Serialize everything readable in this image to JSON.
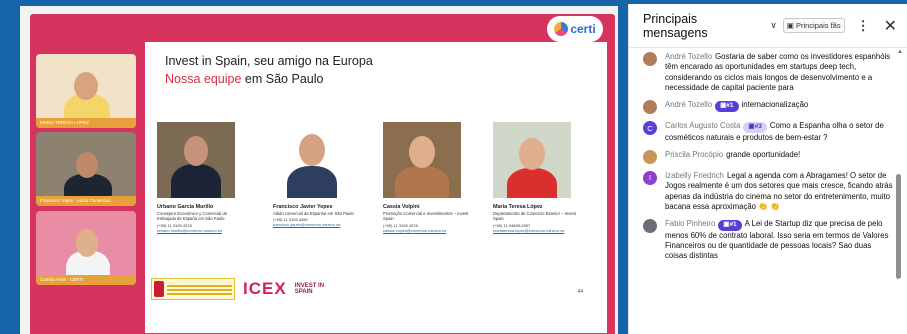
{
  "stage": {
    "participants": [
      {
        "caption": "MARIA TERESA LOPEZ"
      },
      {
        "caption": "Francisco Yepes · Adido Comercial..."
      },
      {
        "caption": "Camila Arruè · CERTI"
      }
    ],
    "logo_text": "certi",
    "slide": {
      "title": "Invest in Spain, seu amigo na Europa",
      "subtitle_red": "Nossa equipe",
      "subtitle_rest": " em São Paulo",
      "members": [
        {
          "name": "Urbano García Murillo",
          "role": "Consejero Económico y Comercial de Embajada de España em São Paulo",
          "tel": "(+55) 11 3105 4378",
          "mail": "urbano.murillo@comercio.mineco.es"
        },
        {
          "name": "Francisco Javier Yepes",
          "role": "Adido comercial da Espanha em São Paulo",
          "tel": "(+55) 11 3105 4380",
          "mail": "francisco.yepes@comercio.mineco.es"
        },
        {
          "name": "Cassia Volpini",
          "role": "Promoção Comercial e Investimentos – Invest Spain",
          "tel": "(+55) 11 3105 4378",
          "mail": "cassia.volpini@comercio.mineco.es"
        },
        {
          "name": "María Teresa López",
          "role": "Departamento de Comercio Exterior – Invest Spain",
          "tel": "(+55) 11 94895-0957",
          "mail": "mariateresa.lopez@comercio.mineco.es"
        }
      ],
      "icex_label": "ICEX",
      "invest_line1": "INVEST IN",
      "invest_line2": "SPAIN",
      "page_number": "44"
    }
  },
  "chat": {
    "title": "Principais mensagens",
    "pinned_button": "Principais fãs",
    "messages": [
      {
        "author": "André Tozello",
        "badge": "",
        "text": "Gostaria de saber como os investidores espanhóis têm encarado as oportunidades em startups deep tech, considerando os ciclos mais longos de desenvolvimento e a necessidade de capital paciente para",
        "avatar_color": "#b07f5a",
        "avatar_letter": ""
      },
      {
        "author": "André Tozello",
        "badge": "#1",
        "text": "internacionalização",
        "avatar_color": "#b07f5a",
        "avatar_letter": ""
      },
      {
        "author": "Carlos Augusto Costa",
        "badge": "#3",
        "text": "Como a Espanha olha o setor de cosméticos naturais e produtos de bem-estar ?",
        "avatar_color": "#5b3fd6",
        "avatar_letter": "C"
      },
      {
        "author": "Priscila Procópio",
        "badge": "",
        "text": "grande oportunidade!",
        "avatar_color": "#c9955b",
        "avatar_letter": ""
      },
      {
        "author": "Izabelly Friedrich",
        "badge": "",
        "text": "Legal a agenda com a Abragames! O setor de Jogos realmente é um dos setores que mais cresce, ficando atrás apenas da indústria do cinema no setor do entretenimento, muito bacana essa aproximação 👏 👏",
        "avatar_color": "#8e3fd2",
        "avatar_letter": "I"
      },
      {
        "author": "Fabio Pinheiro",
        "badge": "#1",
        "text": "A Lei de Startup diz que precisa de pelo menos 60% de contrato laboral. Isso seria em termos de Valores Financeiros ou de quantidade de pessoas locais? Sao duas coisas distintas",
        "avatar_color": "#6d6f78",
        "avatar_letter": ""
      }
    ]
  }
}
